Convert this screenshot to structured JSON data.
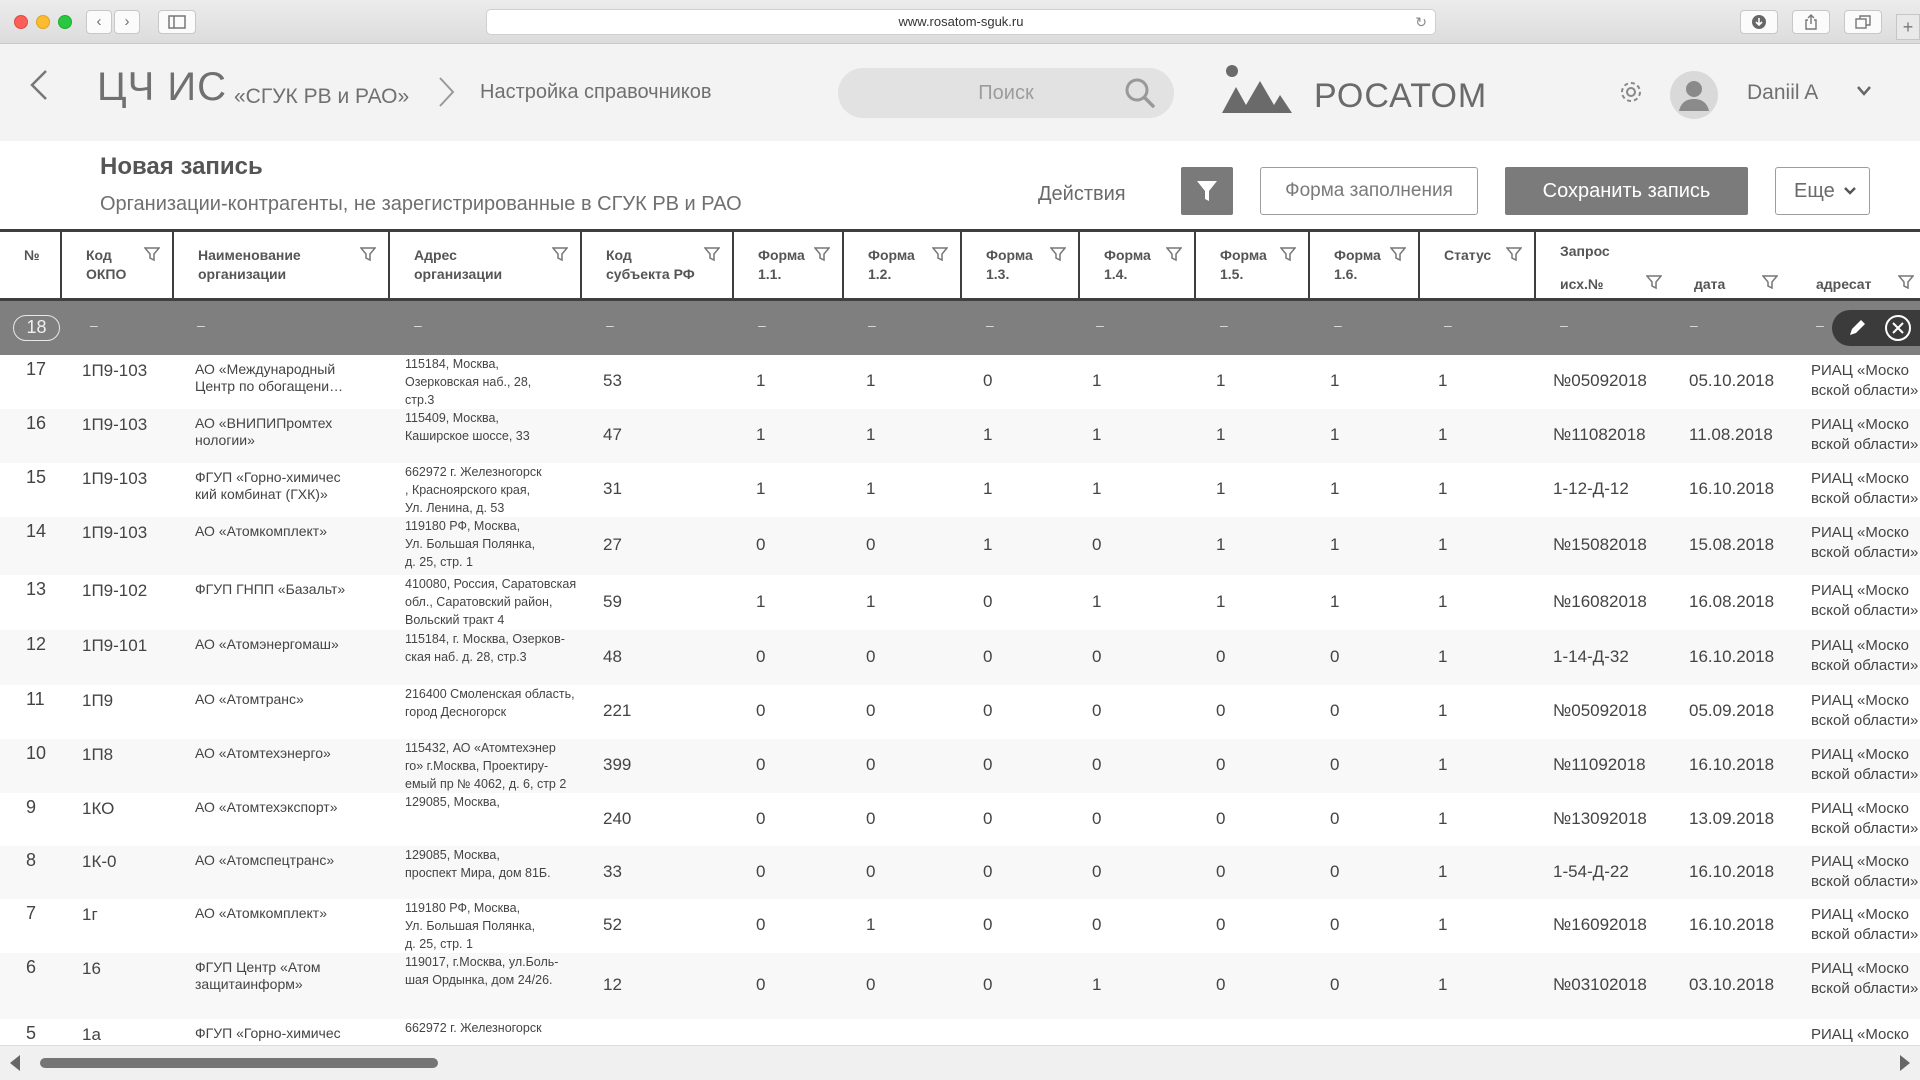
{
  "browser": {
    "url": "www.rosatom-sguk.ru",
    "new_tab": "+"
  },
  "header": {
    "back": "‹",
    "app_title": "ЦЧ ИС",
    "app_subtitle": "«СГУК РВ и РАО»",
    "breadcrumb_sep": "›",
    "breadcrumb": "Настройка справочников",
    "search_placeholder": "Поиск",
    "brand": "РОСАТОМ",
    "user": "Daniil A"
  },
  "record": {
    "title": "Новая запись",
    "subtitle": "Организации-контрагенты, не зарегистрированные в СГУК РВ и РАО",
    "actions_label": "Действия",
    "form_button": "Форма заполнения",
    "save_button": "Сохранить запись",
    "more_button": "Еще"
  },
  "columns": {
    "num": "№",
    "okpo": "Код\nОКПО",
    "name": "Наименование\nорганизации",
    "address": "Адрес\nорганизации",
    "subject": "Код\nсубъекта РФ",
    "f11": "Форма\n1.1.",
    "f12": "Форма\n1.2.",
    "f13": "Форма\n1.3.",
    "f14": "Форма\n1.4.",
    "f15": "Форма\n1.5.",
    "f16": "Форма\n1.6.",
    "status": "Статус",
    "request": "Запрос",
    "req_num": "исх.№",
    "req_date": "дата",
    "req_addr": "адресат"
  },
  "edit_row": {
    "number": "18",
    "placeholder": "–"
  },
  "rows": [
    {
      "n": "17",
      "okpo": "1П9-103",
      "name": "АО «Международный\nЦентр по обогащени…",
      "addr": "115184, Москва,\nОзерковская наб., 28,\nстр.3",
      "subj": "53",
      "f": [
        "1",
        "1",
        "0",
        "1",
        "1",
        "1"
      ],
      "status": "1",
      "rnum": "№05092018",
      "rdate": "05.10.2018",
      "raddr": "РИАЦ «Моско\nвской области»"
    },
    {
      "n": "16",
      "okpo": "1П9-103",
      "name": "АО «ВНИПИПромтех\nнологии»",
      "addr": "115409, Москва,\nКаширское шоссе, 33",
      "subj": "47",
      "f": [
        "1",
        "1",
        "1",
        "1",
        "1",
        "1"
      ],
      "status": "1",
      "rnum": "№11082018",
      "rdate": "11.08.2018",
      "raddr": "РИАЦ «Моско\nвской области»"
    },
    {
      "n": "15",
      "okpo": "1П9-103",
      "name": "ФГУП «Горно-химичес\nкий комбинат (ГХК)»",
      "addr": "662972 г. Железногорск\n, Красноярского края,\nУл. Ленина, д. 53",
      "subj": "31",
      "f": [
        "1",
        "1",
        "1",
        "1",
        "1",
        "1"
      ],
      "status": "1",
      "rnum": "1-12-Д-12",
      "rdate": "16.10.2018",
      "raddr": "РИАЦ «Моско\nвской области»"
    },
    {
      "n": "14",
      "okpo": "1П9-103",
      "name": "АО «Атомкомплект»",
      "addr": "119180 РФ, Москва,\nУл. Большая Полянка,\nд. 25, стр. 1",
      "subj": "27",
      "f": [
        "0",
        "0",
        "1",
        "0",
        "1",
        "1"
      ],
      "status": "1",
      "rnum": "№15082018",
      "rdate": "15.08.2018",
      "raddr": "РИАЦ «Моско\nвской области»"
    },
    {
      "n": "13",
      "okpo": "1П9-102",
      "name": "ФГУП ГНПП «Базальт»",
      "addr": "410080, Россия, Саратовская\nобл., Саратовский район,\nВольский тракт 4",
      "subj": "59",
      "f": [
        "1",
        "1",
        "0",
        "1",
        "1",
        "1"
      ],
      "status": "1",
      "rnum": "№16082018",
      "rdate": "16.08.2018",
      "raddr": "РИАЦ «Моско\nвской области»"
    },
    {
      "n": "12",
      "okpo": "1П9-101",
      "name": "АО «Атомэнергомаш»",
      "addr": "115184, г. Москва, Озерков-\nская наб. д. 28, стр.3",
      "subj": "48",
      "f": [
        "0",
        "0",
        "0",
        "0",
        "0",
        "0"
      ],
      "status": "1",
      "rnum": "1-14-Д-32",
      "rdate": "16.10.2018",
      "raddr": "РИАЦ «Моско\nвской области»"
    },
    {
      "n": "11",
      "okpo": "1П9",
      "name": "АО «Атомтранс»",
      "addr": "216400 Смоленская область,\nгород Десногорск",
      "subj": "221",
      "f": [
        "0",
        "0",
        "0",
        "0",
        "0",
        "0"
      ],
      "status": "1",
      "rnum": "№05092018",
      "rdate": "05.09.2018",
      "raddr": "РИАЦ «Моско\nвской области»"
    },
    {
      "n": "10",
      "okpo": "1П8",
      "name": "АО «Атомтехэнерго»",
      "addr": "115432, АО «Атомтехэнер\nго» г.Москва, Проектиру-\nемый пр № 4062, д. 6, стр 2",
      "subj": "399",
      "f": [
        "0",
        "0",
        "0",
        "0",
        "0",
        "0"
      ],
      "status": "1",
      "rnum": "№11092018",
      "rdate": "16.10.2018",
      "raddr": "РИАЦ «Моско\nвской области»"
    },
    {
      "n": "9",
      "okpo": "1КО",
      "name": "АО «Атомтехэкспорт»",
      "addr": "129085, Москва,",
      "subj": "240",
      "f": [
        "0",
        "0",
        "0",
        "0",
        "0",
        "0"
      ],
      "status": "1",
      "rnum": "№13092018",
      "rdate": "13.09.2018",
      "raddr": "РИАЦ «Моско\nвской области»"
    },
    {
      "n": "8",
      "okpo": "1К-0",
      "name": "АО «Атомспецтранс»",
      "addr": "129085, Москва,\nпроспект Мира, дом 81Б.",
      "subj": "33",
      "f": [
        "0",
        "0",
        "0",
        "0",
        "0",
        "0"
      ],
      "status": "1",
      "rnum": "1-54-Д-22",
      "rdate": "16.10.2018",
      "raddr": "РИАЦ «Моско\nвской области»"
    },
    {
      "n": "7",
      "okpo": "1г",
      "name": "АО «Атомкомплект»",
      "addr": "119180 РФ, Москва,\nУл. Большая Полянка,\nд. 25, стр. 1",
      "subj": "52",
      "f": [
        "0",
        "1",
        "0",
        "0",
        "0",
        "0"
      ],
      "status": "1",
      "rnum": "№16092018",
      "rdate": "16.10.2018",
      "raddr": "РИАЦ «Моско\nвской области»"
    },
    {
      "n": "6",
      "okpo": "16",
      "name": "ФГУП Центр «Атом\nзащитаинформ»",
      "addr": "119017, г.Москва, ул.Боль-\nшая Ордынка, дом 24/26.",
      "subj": "12",
      "f": [
        "0",
        "0",
        "0",
        "1",
        "0",
        "0"
      ],
      "status": "1",
      "rnum": "№03102018",
      "rdate": "03.10.2018",
      "raddr": "РИАЦ «Моско\nвской области»"
    },
    {
      "n": "5",
      "okpo": "1а",
      "name": "ФГУП «Горно-химичес",
      "addr": "662972 г. Железногорск",
      "subj": "",
      "f": [
        "",
        "",
        "",
        "",
        "",
        ""
      ],
      "status": "",
      "rnum": "",
      "rdate": "",
      "raddr": "РИАЦ «Моско"
    }
  ]
}
